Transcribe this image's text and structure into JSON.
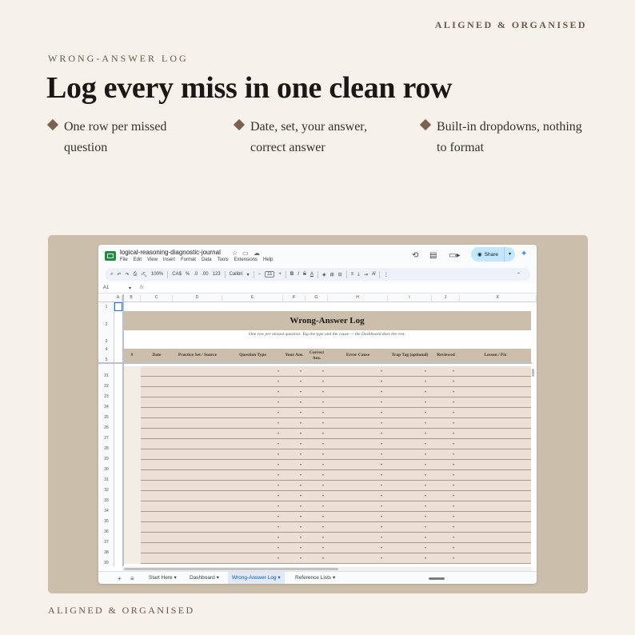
{
  "brand": {
    "top": "ALIGNED & ORGANISED",
    "bottom": "ALIGNED & ORGANISED"
  },
  "eyebrow": "WRONG-ANSWER LOG",
  "headline": "Log every miss in one clean row",
  "features": [
    {
      "line1": "One row per missed",
      "line2": "question"
    },
    {
      "line1": "Date, set, your answer,",
      "line2": "correct answer"
    },
    {
      "line1": "Built-in dropdowns, nothing",
      "line2": "to format"
    }
  ],
  "colors": {
    "background": "#f6f1eb",
    "panel": "#cbbeab",
    "accent": "#7a6150",
    "row_fill": "#ebe0d3"
  },
  "sheet": {
    "doc_name": "logical-reasoning-diagnostic-journal",
    "menu": [
      "File",
      "Edit",
      "View",
      "Insert",
      "Format",
      "Data",
      "Tools",
      "Extensions",
      "Help"
    ],
    "share_label": "Share",
    "toolbar": {
      "zoom": "100%",
      "currency": "CA$",
      "percent": "%",
      "dec_less": ".0",
      "dec_more": ".00",
      "number_fmt": "123",
      "font": "Calibri",
      "font_size": "11"
    },
    "cell_ref": "A1",
    "fx": "fx",
    "column_letters": [
      "A",
      "B",
      "C",
      "D",
      "E",
      "F",
      "G",
      "H",
      "I",
      "J",
      "K"
    ],
    "row_numbers_top": [
      "1",
      "2",
      "3",
      "4",
      "5"
    ],
    "row_numbers_body": [
      "21",
      "22",
      "23",
      "24",
      "25",
      "26",
      "27",
      "28",
      "29",
      "30",
      "31",
      "32",
      "33",
      "34",
      "35",
      "36",
      "37",
      "38",
      "39"
    ],
    "title": "Wrong-Answer Log",
    "subtitle": "One row per missed question. Tag the type and the cause — the Dashboard does the rest.",
    "headers": [
      "#",
      "Date",
      "Practice Set / Source",
      "Question Type",
      "Your Ans.",
      "Correct Ans.",
      "Error Cause",
      "Trap Tag (optional)",
      "Reviewed",
      "Lesson / Fix"
    ],
    "tabs": [
      "Start Here",
      "Dashboard",
      "Wrong-Answer Log",
      "Reference Lists"
    ],
    "active_tab": "Wrong-Answer Log",
    "icons": [
      "sheets-logo-icon",
      "star-icon",
      "move-folder-icon",
      "cloud-icon",
      "history-icon",
      "comment-icon",
      "video-call-icon",
      "globe-icon",
      "gemini-icon",
      "search-icon",
      "undo-icon",
      "redo-icon",
      "print-icon",
      "paint-format-icon",
      "add-sheet-icon",
      "all-sheets-icon"
    ]
  }
}
